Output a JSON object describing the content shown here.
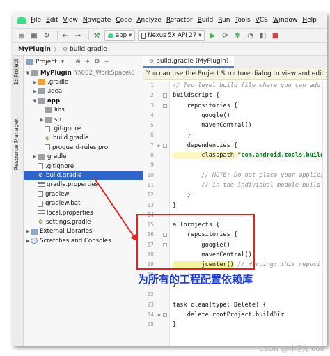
{
  "menu": [
    "File",
    "Edit",
    "View",
    "Navigate",
    "Code",
    "Analyze",
    "Refactor",
    "Build",
    "Run",
    "Tools",
    "VCS",
    "Window",
    "Help"
  ],
  "toolbar": {
    "run_config": "app",
    "device": "Nexus 5X API 27",
    "config_arrow": "▾"
  },
  "breadcrumb": {
    "project": "MyPlugin",
    "file": "build.gradle"
  },
  "sidebar_tabs": {
    "project": "1: Project",
    "resource_manager": "Resource Manager"
  },
  "project_pane": {
    "view": "Project",
    "items": [
      {
        "label": "MyPlugin",
        "extra": "Y:\\002_WorkSpace\\0"
      },
      {
        "label": ".gradle"
      },
      {
        "label": ".idea"
      },
      {
        "label": "app"
      },
      {
        "label": "libs"
      },
      {
        "label": "src"
      },
      {
        "label": ".gitignore"
      },
      {
        "label": "build.gradle"
      },
      {
        "label": "proguard-rules.pro"
      },
      {
        "label": "gradle"
      },
      {
        "label": ".gitignore"
      },
      {
        "label": "build.gradle"
      },
      {
        "label": "gradle.properties"
      },
      {
        "label": "gradlew"
      },
      {
        "label": "gradlew.bat"
      },
      {
        "label": "local.properties"
      },
      {
        "label": "settings.gradle"
      },
      {
        "label": "External Libraries"
      },
      {
        "label": "Scratches and Consoles"
      }
    ]
  },
  "editor": {
    "tab": "build.gradle (MyPlugin)",
    "notice": "You can use the Project Structure dialog to view and edit your proje",
    "line_numbers": [
      "1",
      "2",
      "3",
      "4",
      "5",
      "6",
      "7",
      "8",
      "9",
      "10",
      "11",
      "12",
      "13",
      "14",
      "15",
      "16",
      "17",
      "18",
      "19",
      "20",
      "21",
      "22",
      "23",
      "24",
      "25"
    ],
    "lines": [
      "// Top-level build file where you can add",
      "buildscript {",
      "    repositories {",
      "        google()",
      "        mavenCentral()",
      "    }",
      "    dependencies {",
      "        classpath ",
      "\"com.android.tools.build",
      "",
      "        // NOTE: Do not place your applica",
      "        // in the individual module build",
      "    }",
      "}",
      "",
      "allprojects {",
      "    repositories {",
      "        google()",
      "        mavenCentral()",
      "        jcenter()",
      " // Warning: this reposi",
      "    }",
      "}",
      "",
      "task clean(type: Delete) {",
      "    delete rootProject.buildDir",
      "}"
    ]
  },
  "annotation": "为所有的工程配置依赖库",
  "watermark": "CSDN @韩曙亮 666",
  "colors": {
    "selection": "#2f65ca",
    "annotation_box": "#e52222",
    "annotation_text": "#1a3cd4"
  }
}
